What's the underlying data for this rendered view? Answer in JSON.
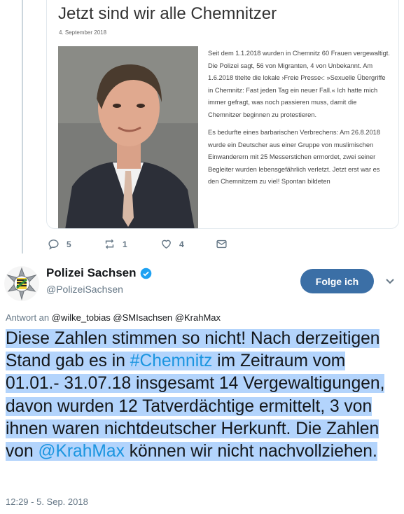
{
  "quoted_article": {
    "title": "Jetzt sind wir alle Chemnitzer",
    "date": "4. September 2018",
    "paragraph1": "Seit dem 1.1.2018 wurden in Chemnitz 60 Frauen vergewaltigt. Die Polizei sagt, 56 von Migranten, 4 von Unbekannt. Am 1.6.2018 titelte die lokale ›Freie Presse‹: »Sexuelle Übergriffe in Chemnitz: Fast jeden Tag ein neuer Fall.« Ich hatte mich immer gefragt, was noch passieren muss, damit die Chemnitzer beginnen zu protestieren.",
    "paragraph2": "Es bedurfte eines barbarischen Verbrechens: Am 26.8.2018 wurde ein Deutscher aus einer Gruppe von muslimischen Einwanderern mit 25 Messerstichen ermordet, zwei seiner Begleiter wurden lebensgefährlich verletzt. Jetzt erst war es den Chemnitzern zu viel! Spontan bildeten"
  },
  "actions": {
    "replies": "5",
    "retweets": "1",
    "likes": "4"
  },
  "tweet": {
    "author_name": "Polizei Sachsen",
    "author_handle": "@PolizeiSachsen",
    "follow_label": "Folge ich",
    "reply_prefix": "Antwort an",
    "reply_mentions": [
      "@wilke_tobias",
      "@SMIsachsen",
      "@KrahMax"
    ],
    "text_part1": "Diese Zahlen stimmen so nicht! Nach derzeitigen Stand gab es in ",
    "hashtag": "#Chemnitz",
    "text_part2": " im Zeitraum vom 01.01.- 31.07.18 insgesamt 14 Vergewaltigungen, davon wurden 12 Tatverdächtige ermittelt, 3 von ihnen waren nichtdeutscher Herkunft. Die Zahlen von ",
    "mention": "@KrahMax",
    "text_part3": " können wir nicht nachvollziehen.",
    "timestamp": "12:29 - 5. Sep. 2018"
  },
  "colors": {
    "link": "#1b95e0",
    "highlight": "#b3d4fc",
    "follow_button": "#3b6fa6",
    "verified": "#1da1f2"
  },
  "icons": [
    "reply-icon",
    "retweet-icon",
    "heart-icon",
    "dm-icon",
    "verified-badge-icon",
    "chevron-down-icon",
    "police-star-logo"
  ]
}
